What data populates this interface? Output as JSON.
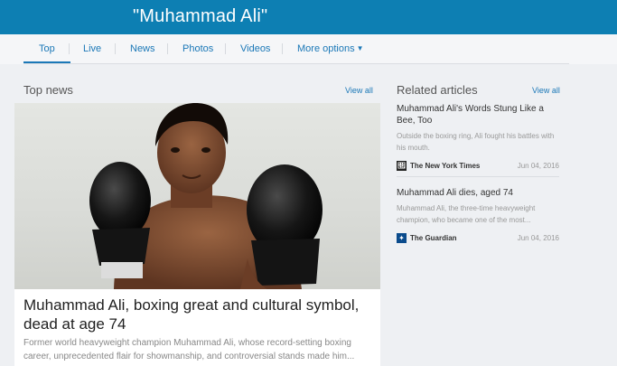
{
  "header": {
    "query": "\"Muhammad Ali\""
  },
  "tabs": [
    {
      "label": "Top"
    },
    {
      "label": "Live"
    },
    {
      "label": "News"
    },
    {
      "label": "Photos"
    },
    {
      "label": "Videos"
    },
    {
      "label": "More options"
    }
  ],
  "top_news": {
    "heading": "Top news",
    "view_all": "View all",
    "headline": "Muhammad Ali, boxing great and cultural symbol, dead at age 74",
    "summary": "Former world heavyweight champion Muhammad Ali, whose record-setting boxing career, unprecedented flair for showmanship, and controversial stands made him..."
  },
  "related": {
    "heading": "Related articles",
    "view_all": "View all",
    "items": [
      {
        "title": "Muhammad Ali's Words Stung Like a Bee, Too",
        "snippet": "Outside the boxing ring, Ali fought his battles with his mouth.",
        "source": "The New York Times",
        "date": "Jun 04, 2016"
      },
      {
        "title": "Muhammad Ali dies, aged 74",
        "snippet": "Muhammad Ali, the three-time heavyweight champion, who became one of the most...",
        "source": "The Guardian",
        "date": "Jun 04, 2016"
      }
    ]
  },
  "colors": {
    "brand": "#0d7fb3",
    "link": "#1b78b7",
    "background": "#eef0f3"
  },
  "icons": {
    "more_options": "chevron-down-icon",
    "nyt": "nyt-logo-icon",
    "guardian": "guardian-logo-icon"
  }
}
